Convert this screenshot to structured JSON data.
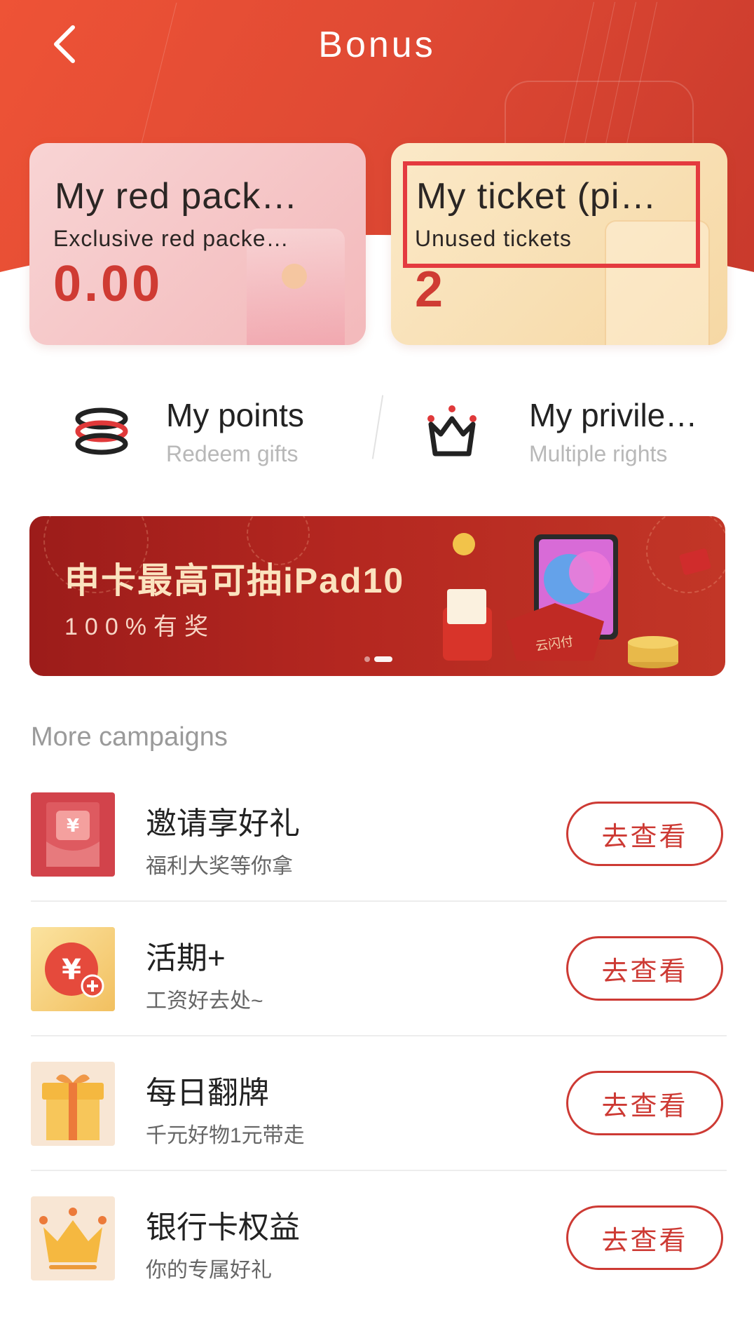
{
  "header": {
    "title": "Bonus",
    "back_icon": "chevron-left-icon"
  },
  "cards": {
    "red_packet": {
      "title": "My red pack…",
      "subtitle": "Exclusive red packe…",
      "value": "0.00"
    },
    "ticket": {
      "title": "My ticket (pi…",
      "subtitle": "Unused tickets",
      "value": "2"
    }
  },
  "quick_links": {
    "points": {
      "title": "My points",
      "subtitle": "Redeem gifts",
      "icon": "coin-stack-icon"
    },
    "privileges": {
      "title": "My privile…",
      "subtitle": "Multiple rights",
      "icon": "crown-icon"
    }
  },
  "banner": {
    "title": "申卡最高可抽iPad10",
    "subtitle": "100%有奖",
    "pay_brand": "云闪付"
  },
  "campaigns": {
    "section_title": "More campaigns",
    "items": [
      {
        "title": "邀请享好礼",
        "subtitle": "福利大奖等你拿",
        "button": "去查看",
        "icon": "red-envelope-icon"
      },
      {
        "title": "活期+",
        "subtitle": "工资好去处~",
        "button": "去查看",
        "icon": "yuan-plus-icon"
      },
      {
        "title": "每日翻牌",
        "subtitle": "千元好物1元带走",
        "button": "去查看",
        "icon": "gift-box-icon"
      },
      {
        "title": "银行卡权益",
        "subtitle": "你的专属好礼",
        "button": "去查看",
        "icon": "crown-icon"
      }
    ]
  },
  "colors": {
    "header_red": "#e04a34",
    "accent_red": "#cd3a34",
    "value_red": "#cf3b33",
    "highlight": "#e43a3f"
  }
}
